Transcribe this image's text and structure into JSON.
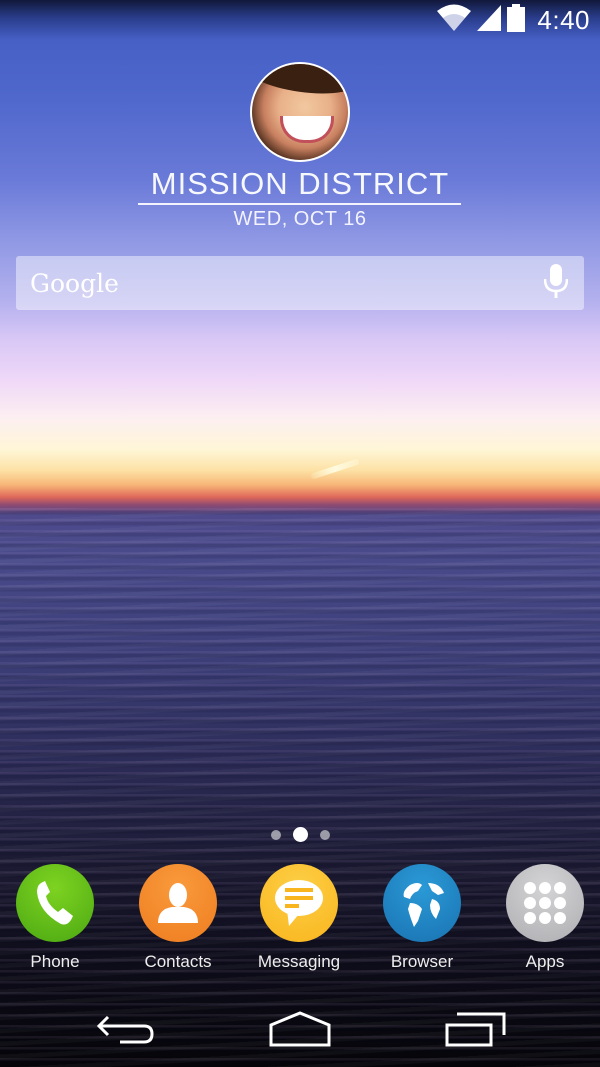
{
  "status_bar": {
    "time": "4:40",
    "icons": [
      "wifi-icon",
      "cell-signal-icon",
      "battery-icon"
    ]
  },
  "header": {
    "avatar": "profile-photo",
    "location": "MISSION DISTRICT",
    "date": "WED, OCT 16"
  },
  "search": {
    "logo": "Google",
    "mic_icon": "microphone-icon"
  },
  "page_indicator": {
    "pages": 3,
    "current": 2
  },
  "dock": {
    "items": [
      {
        "label": "Phone",
        "icon": "phone-icon",
        "color": "#5fbf1a"
      },
      {
        "label": "Contacts",
        "icon": "contacts-icon",
        "color": "#f08a2a"
      },
      {
        "label": "Messaging",
        "icon": "messaging-icon",
        "color": "#fbbd2a"
      },
      {
        "label": "Browser",
        "icon": "globe-icon",
        "color": "#1f82c0"
      },
      {
        "label": "Apps",
        "icon": "apps-grid-icon",
        "color": "#bfbfc2"
      }
    ]
  },
  "nav_bar": {
    "buttons": [
      "back",
      "home",
      "recents"
    ]
  }
}
